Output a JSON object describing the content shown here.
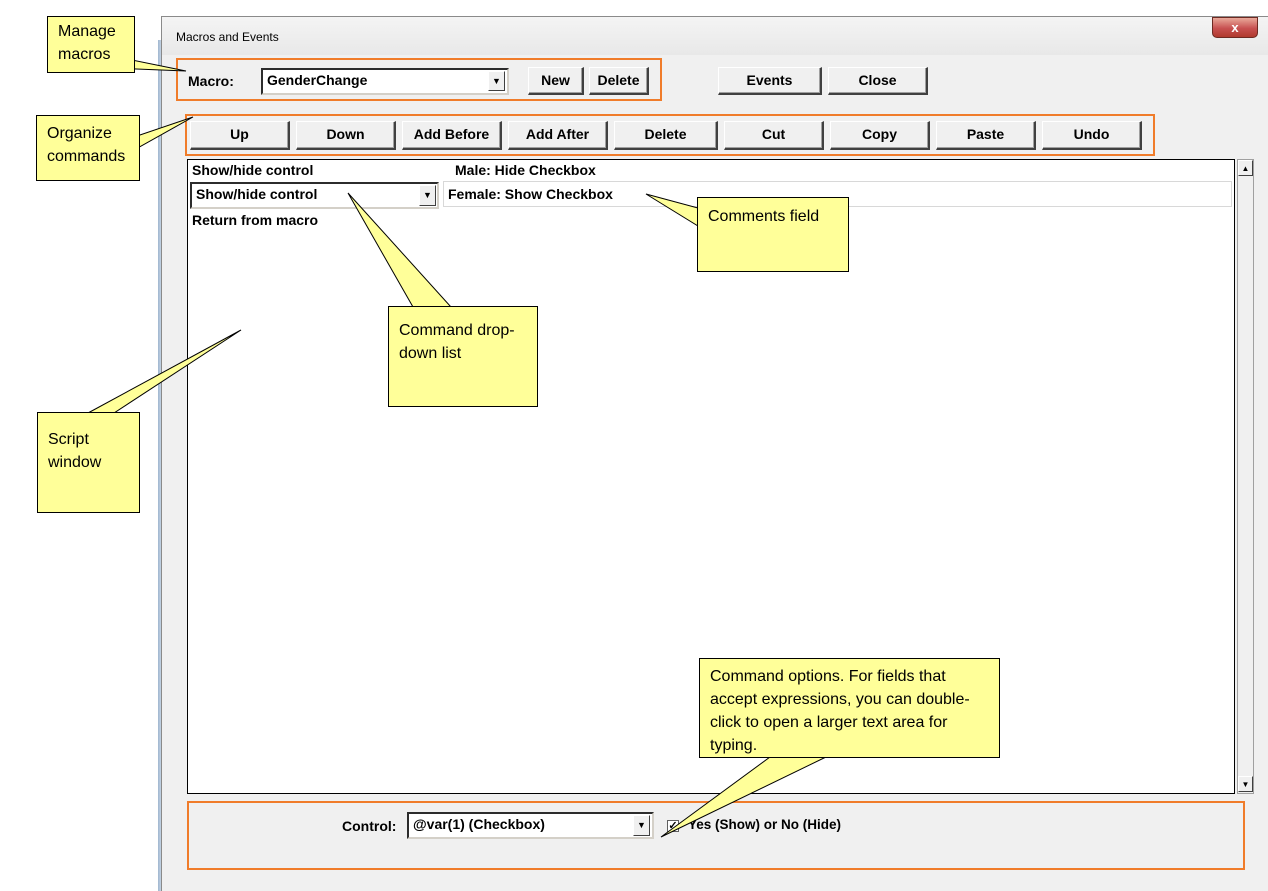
{
  "window": {
    "title": "Macros and Events",
    "close_glyph": "x"
  },
  "macro_bar": {
    "label": "Macro:",
    "selected": "GenderChange",
    "new_label": "New",
    "delete_label": "Delete",
    "events_label": "Events",
    "close_label": "Close"
  },
  "command_bar": {
    "buttons": [
      "Up",
      "Down",
      "Add Before",
      "Add After",
      "Delete",
      "Cut",
      "Copy",
      "Paste",
      "Undo"
    ]
  },
  "script": {
    "rows": [
      {
        "command": "Show/hide control",
        "comment": "Male: Hide Checkbox"
      },
      {
        "command": "Show/hide control",
        "comment": "Female: Show Checkbox"
      },
      {
        "command": "Return from macro",
        "comment": ""
      }
    ]
  },
  "options": {
    "control_label": "Control:",
    "control_value": "@var(1) (Checkbox)",
    "checkbox_checked": true,
    "checkbox_label": "Yes (Show) or No (Hide)"
  },
  "callouts": {
    "manage_macros": "Manage macros",
    "organize_commands": "Organize commands",
    "comments_field": "Comments field",
    "command_dropdown": "Command drop-down list",
    "script_window": "Script window",
    "command_options": "Command options. For fields that accept expressions,  you can double-click to open a larger text area for typing."
  },
  "colors": {
    "highlight_border": "#f07c2a",
    "callout_fill": "#ffff99",
    "window_bg": "#f0f0f0"
  }
}
